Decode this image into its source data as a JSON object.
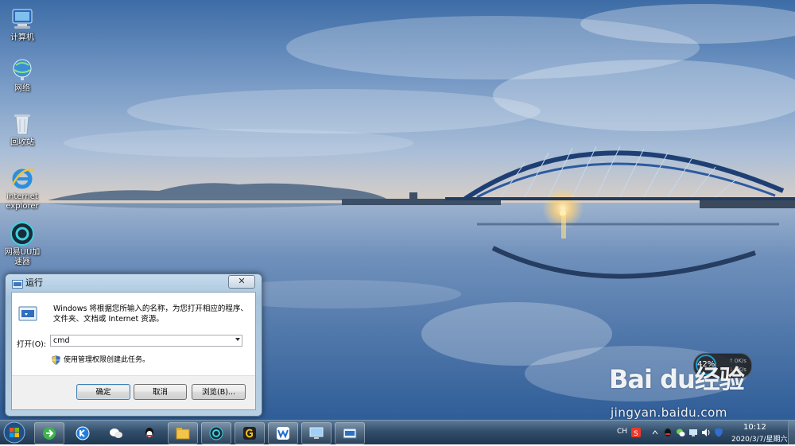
{
  "desktop": {
    "icons": [
      {
        "label": "计算机",
        "icon": "computer-icon"
      },
      {
        "label": "网络",
        "icon": "network-icon"
      },
      {
        "label": "回收站",
        "icon": "recycle-bin-icon"
      },
      {
        "label": "internet explorer",
        "icon": "internet-explorer-icon"
      },
      {
        "label": "网易UU加速器",
        "icon": "uu-accelerator-icon"
      }
    ]
  },
  "run_dialog": {
    "title": "运行",
    "close_label": "✕",
    "description": "Windows 将根据您所输入的名称，为您打开相应的程序、文件夹、文档或 Internet 资源。",
    "open_label": "打开(O):",
    "input_value": "cmd",
    "admin_note": "使用管理权限创建此任务。",
    "buttons": {
      "ok": "确定",
      "cancel": "取消",
      "browse": "浏览(B)..."
    }
  },
  "taskbar": {
    "pinned": [
      "360-browser-icon",
      "kugou-icon",
      "wechat-icon",
      "qq-icon",
      "file-explorer-icon",
      "uu-accelerator-icon",
      "game-app-icon",
      "wps-icon",
      "remote-desktop-icon",
      "run-icon"
    ],
    "tray": {
      "input_method": "CH",
      "time": "10:12",
      "date": "2020/3/7/星期六"
    }
  },
  "net_widget": {
    "percent": "42%",
    "upload": "0K/s",
    "download": "0K/s"
  },
  "watermark": {
    "logo": "Bai du经验",
    "url": "jingyan.baidu.com"
  },
  "colors": {
    "sky_top": "#3f6fa8",
    "water": "#5d82b1",
    "taskbar": "#2a4562",
    "dialog_frame": "#b0cbe2"
  }
}
